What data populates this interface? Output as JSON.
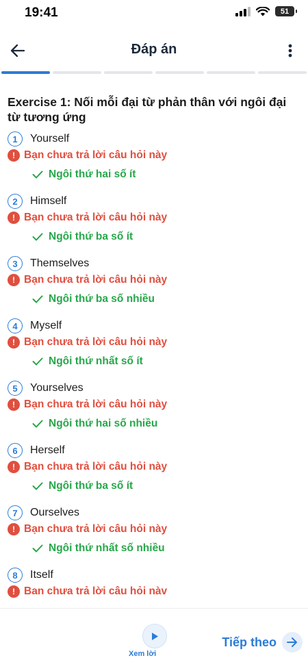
{
  "status": {
    "time": "19:41",
    "battery": "51"
  },
  "header": {
    "title": "Đáp án"
  },
  "progress_segments": 6,
  "exercise": {
    "title": "Exercise 1: Nối mỗi đại từ phản thân với ngôi đại từ tương ứng",
    "unanswered_text": "Bạn chưa trả lời câu hỏi này",
    "questions": [
      {
        "number": "1",
        "word": "Yourself",
        "answer": "Ngôi thứ hai số ít"
      },
      {
        "number": "2",
        "word": "Himself",
        "answer": "Ngôi thứ ba số ít"
      },
      {
        "number": "3",
        "word": "Themselves",
        "answer": "Ngôi thứ ba số nhiều"
      },
      {
        "number": "4",
        "word": "Myself",
        "answer": "Ngôi thứ nhất số ít"
      },
      {
        "number": "5",
        "word": "Yourselves",
        "answer": "Ngôi thứ hai số nhiều"
      },
      {
        "number": "6",
        "word": "Herself",
        "answer": "Ngôi thứ ba số ít"
      },
      {
        "number": "7",
        "word": "Ourselves",
        "answer": "Ngôi thứ nhất số nhiều"
      },
      {
        "number": "8",
        "word": "Itself",
        "answer": ""
      }
    ],
    "q8_unanswered_text": "Ban chưa trả lời câu hỏi nàv"
  },
  "bottom": {
    "play_label": "Xem lời",
    "next_label": "Tiếp theo"
  },
  "colors": {
    "accent": "#2b7cd6",
    "error": "#e04f3f",
    "success": "#27a74a"
  }
}
